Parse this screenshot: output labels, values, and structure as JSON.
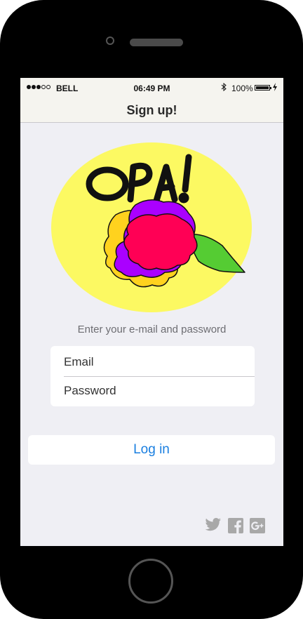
{
  "status_bar": {
    "carrier": "BELL",
    "time": "06:49 PM",
    "battery_percent": "100%",
    "signal_bars_filled": 3,
    "signal_bars_total": 5
  },
  "nav": {
    "title": "Sign up!"
  },
  "logo": {
    "text": "OPA!"
  },
  "login": {
    "subtitle": "Enter your e-mail and password",
    "email_placeholder": "Email",
    "password_placeholder": "Password",
    "login_label": "Log in"
  },
  "social": {
    "icons": [
      "twitter-icon",
      "facebook-icon",
      "google-plus-icon"
    ]
  },
  "colors": {
    "accent": "#1a7fe0",
    "screen_background": "#efeff4",
    "bar_background": "#f5f4ef",
    "logo_background": "#fcf962",
    "flower_red": "#ff0055",
    "flower_purple": "#aa00ff",
    "flower_yellow": "#ffd21e",
    "leaf_green": "#55cc33"
  }
}
